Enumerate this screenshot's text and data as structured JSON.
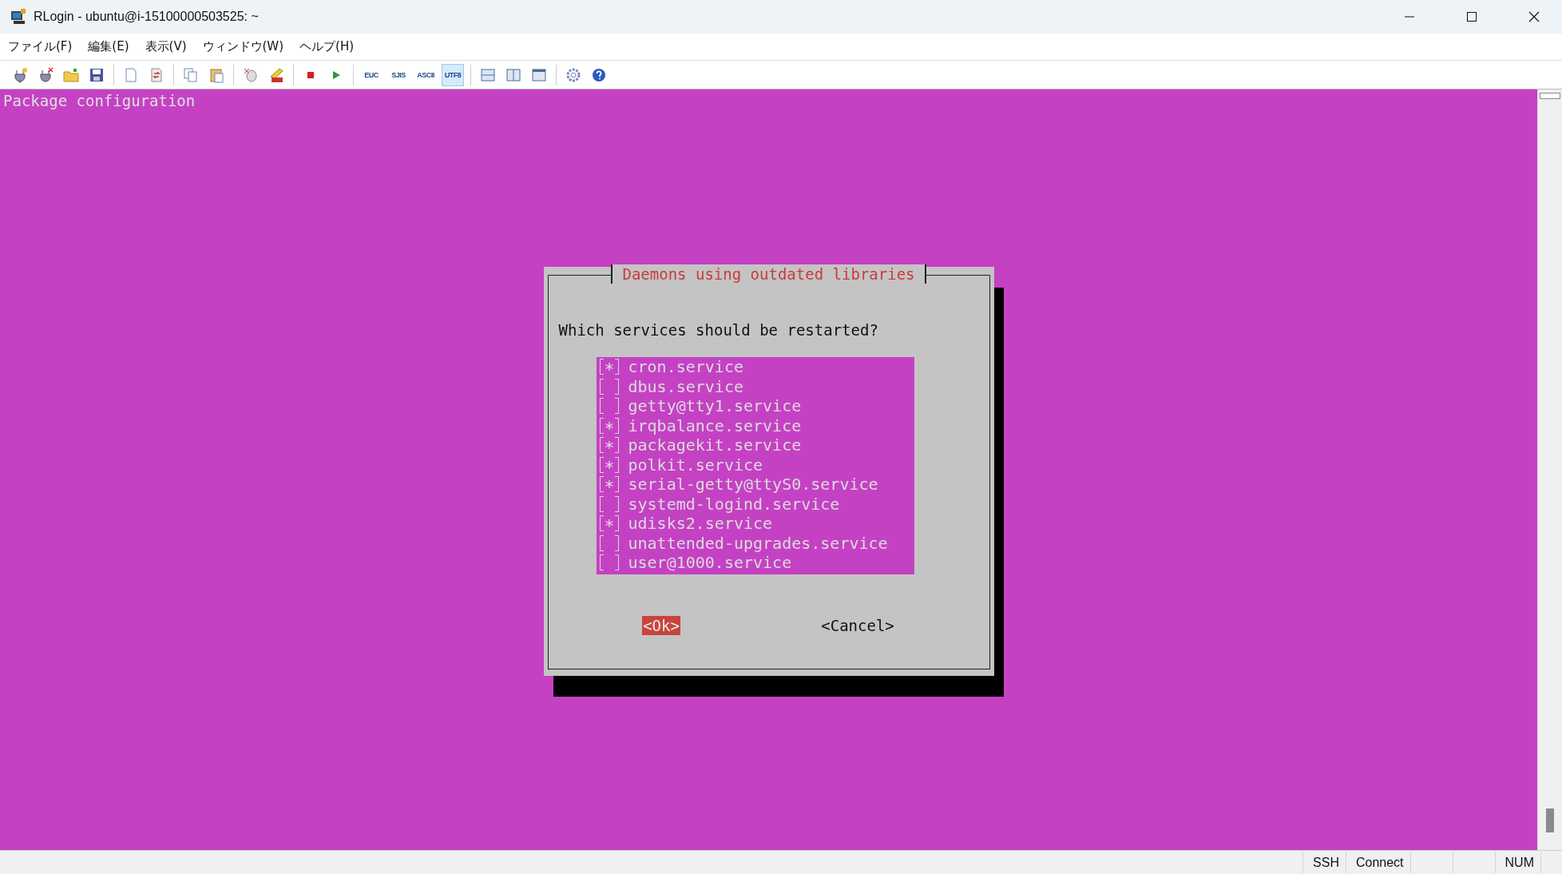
{
  "window": {
    "title": "RLogin - ubuntu@i-15100000503525: ~"
  },
  "menu": [
    "ファイル(F)",
    "編集(E)",
    "表示(V)",
    "ウィンドウ(W)",
    "ヘルプ(H)"
  ],
  "toolbar": {
    "encodings": [
      {
        "label": "EUC",
        "selected": false
      },
      {
        "label": "SJIS",
        "selected": false
      },
      {
        "label": "ASCII",
        "selected": false
      },
      {
        "label": "UTF8",
        "selected": true
      }
    ]
  },
  "terminal": {
    "header": "Package configuration",
    "dialog": {
      "title": "Daemons using outdated libraries",
      "question": "Which services should be restarted?",
      "items": [
        {
          "name": "cron.service",
          "checked": true
        },
        {
          "name": "dbus.service",
          "checked": false
        },
        {
          "name": "getty@tty1.service",
          "checked": false
        },
        {
          "name": "irqbalance.service",
          "checked": true
        },
        {
          "name": "packagekit.service",
          "checked": true
        },
        {
          "name": "polkit.service",
          "checked": true
        },
        {
          "name": "serial-getty@ttyS0.service",
          "checked": true
        },
        {
          "name": "systemd-logind.service",
          "checked": false
        },
        {
          "name": "udisks2.service",
          "checked": true
        },
        {
          "name": "unattended-upgrades.service",
          "checked": false
        },
        {
          "name": "user@1000.service",
          "checked": false
        }
      ],
      "buttons": [
        {
          "label": "<Ok>",
          "selected": true
        },
        {
          "label": "<Cancel>",
          "selected": false
        }
      ]
    }
  },
  "status_bar": {
    "left": [
      "SSH",
      "Connect"
    ],
    "right": [
      "NUM"
    ]
  }
}
